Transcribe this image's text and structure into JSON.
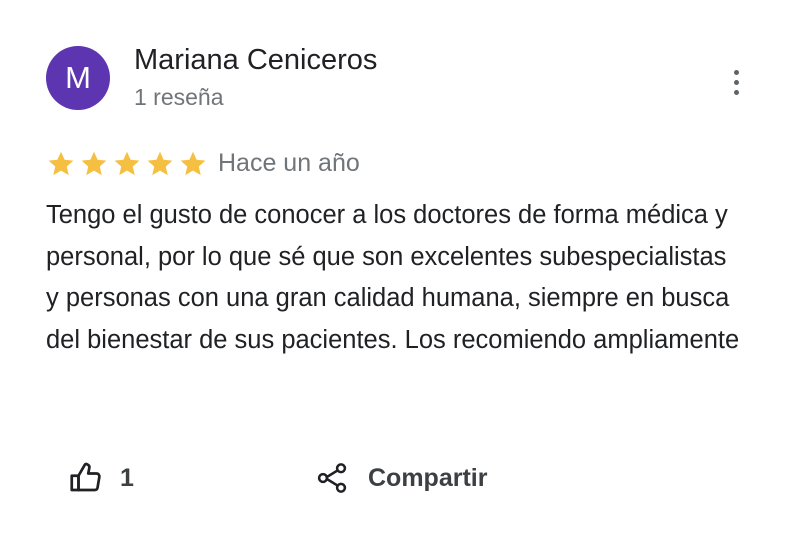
{
  "reviewer": {
    "initial": "M",
    "name": "Mariana Ceniceros",
    "meta": "1 reseña",
    "avatar_color": "#5e35b1"
  },
  "review": {
    "rating": 5,
    "max_rating": 5,
    "star_color": "#f5bf42",
    "date": "Hace un año",
    "text": "Tengo el gusto de conocer a los doctores de forma médica y personal, por lo que sé que son excelentes subespecialistas y personas con una gran calidad humana, siempre en busca del bienestar de sus pacientes. Los recomiendo ampliamente"
  },
  "actions": {
    "like_icon": "thumbs-up-icon",
    "like_count": "1",
    "share_icon": "share-icon",
    "share_label": "Compartir",
    "more_icon": "more-vertical-icon"
  }
}
